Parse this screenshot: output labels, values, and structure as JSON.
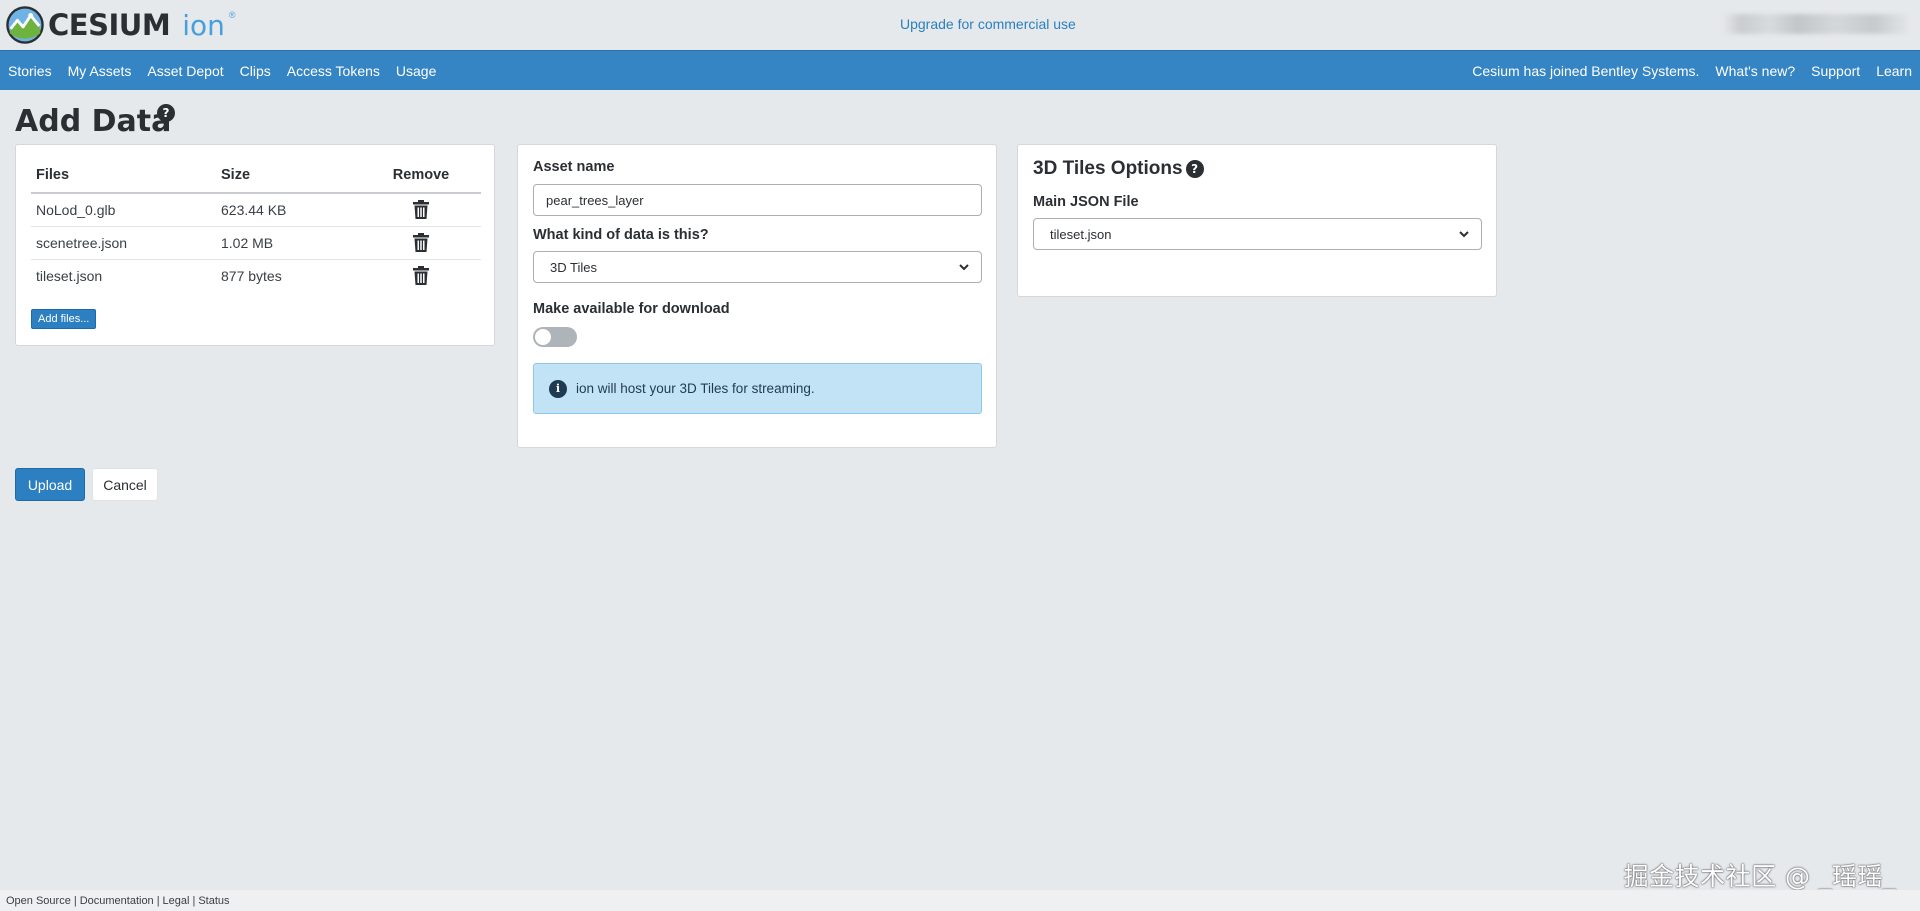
{
  "header": {
    "logo_text": "CESIUM",
    "logo_suffix": "ion",
    "logo_tm": "®",
    "upgrade_link": "Upgrade for commercial use"
  },
  "nav": {
    "left": [
      "Stories",
      "My Assets",
      "Asset Depot",
      "Clips",
      "Access Tokens",
      "Usage"
    ],
    "right": [
      "Cesium has joined Bentley Systems.",
      "What's new?",
      "Support",
      "Learn"
    ]
  },
  "page": {
    "title": "Add Data",
    "help_glyph": "?"
  },
  "files": {
    "headers": {
      "files": "Files",
      "size": "Size",
      "remove": "Remove"
    },
    "rows": [
      {
        "name": "NoLod_0.glb",
        "size": "623.44 KB"
      },
      {
        "name": "scenetree.json",
        "size": "1.02 MB"
      },
      {
        "name": "tileset.json",
        "size": "877 bytes"
      }
    ],
    "add_button": "Add files..."
  },
  "asset": {
    "name_label": "Asset name",
    "name_value": "pear_trees_layer",
    "kind_label": "What kind of data is this?",
    "kind_value": "3D Tiles",
    "download_label": "Make available for download",
    "download_enabled": false,
    "info_text": "ion will host your 3D Tiles for streaming.",
    "info_glyph": "i"
  },
  "tiles_options": {
    "title": "3D Tiles Options",
    "json_label": "Main JSON File",
    "json_value": "tileset.json"
  },
  "actions": {
    "upload": "Upload",
    "cancel": "Cancel"
  },
  "footer": {
    "links": [
      "Open Source",
      "Documentation",
      "Legal",
      "Status"
    ],
    "separator": "|"
  },
  "watermark": "掘金技术社区 @ _瑶瑶_",
  "colors": {
    "navbar": "#3585c4",
    "primary_button": "#2c7fc0",
    "info_bg": "#c2e3f6",
    "page_bg": "#e6e9ec",
    "link": "#2b7fbf"
  }
}
